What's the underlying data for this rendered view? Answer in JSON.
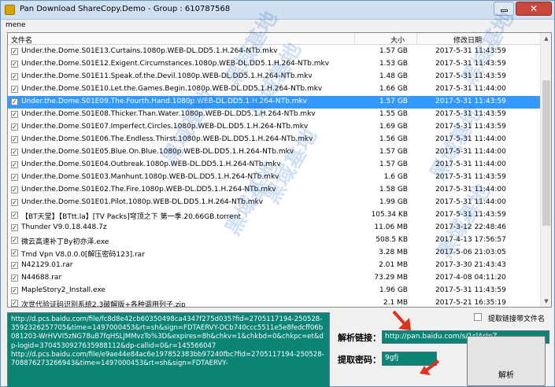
{
  "window": {
    "title": "Pan Download ShareCopy.Demo - Group : 610787568",
    "close_glyph": "✕"
  },
  "menu": {
    "items": [
      {
        "label": "mene"
      }
    ]
  },
  "file_list": {
    "columns": {
      "name": "文件名",
      "size": "大小",
      "date": "修改日期"
    },
    "rows": [
      {
        "name": "Under.the.Dome.S01E13.Curtains.1080p.WEB-DL.DD5.1.H.264-NTb.mkv",
        "size": "1.57 GB",
        "date": "2017-5-31 11:43:59",
        "checked": true,
        "selected": false
      },
      {
        "name": "Under.the.Dome.S01E12.Exigent.Circumstances.1080p.WEB-DL.DD5.1.H.264-NTb.mkv",
        "size": "1.53 GB",
        "date": "2017-5-31 11:43:59",
        "checked": true,
        "selected": false
      },
      {
        "name": "Under.the.Dome.S01E11.Speak.of.the.Devil.1080p.WEB-DL.DD5.1.H.264-NTb.mkv",
        "size": "1.48 GB",
        "date": "2017-5-31 11:43:59",
        "checked": true,
        "selected": false
      },
      {
        "name": "Under.the.Dome.S01E10.Let.the.Games.Begin.1080p.WEB-DL.DD5.1.H.264-NTb.mkv",
        "size": "1.66 GB",
        "date": "2017-5-31 11:44:00",
        "checked": true,
        "selected": false
      },
      {
        "name": "Under.the.Dome.S01E09.The.Fourth.Hand.1080p.WEB-DL.DD5.1.H.264-NTb.mkv",
        "size": "1.57 GB",
        "date": "2017-5-31 11:43:59",
        "checked": true,
        "selected": true
      },
      {
        "name": "Under.the.Dome.S01E08.Thicker.Than.Water.1080p.WEB-DL.DD5.1.H.264-NTb.mkv",
        "size": "1.55 GB",
        "date": "2017-5-31 11:43:59",
        "checked": true,
        "selected": false
      },
      {
        "name": "Under.the.Dome.S01E07.Imperfect.Circles.1080p.WEB-DL.DD5.1.H.264-NTb.mkv",
        "size": "1.69 GB",
        "date": "2017-5-31 11:43:59",
        "checked": true,
        "selected": false
      },
      {
        "name": "Under.the.Dome.S01E06.The.Endless.Thirst.1080p.WEB-DL.DD5.1.H.264-NTb.mkv",
        "size": "1.56 GB",
        "date": "2017-5-31 11:44:00",
        "checked": true,
        "selected": false
      },
      {
        "name": "Under.the.Dome.S01E05.Blue.On.Blue.1080p.WEB-DL.DD5.1.H.264-NTb.mkv",
        "size": "1.57 GB",
        "date": "2017-5-31 11:44:00",
        "checked": true,
        "selected": false
      },
      {
        "name": "Under.the.Dome.S01E04.Outbreak.1080p.WEB-DL.DD5.1.H.264-NTb.mkv",
        "size": "1.57 GB",
        "date": "2017-5-31 11:44:00",
        "checked": true,
        "selected": false
      },
      {
        "name": "Under.the.Dome.S01E03.Manhunt.1080p.WEB-DL.DD5.1.H.264-NTb.mkv",
        "size": "1.6 GB",
        "date": "2017-5-31 11:43:59",
        "checked": true,
        "selected": false
      },
      {
        "name": "Under.the.Dome.S01E02.The.Fire.1080p.WEB-DL.DD5.1.H.264-NTb.mkv",
        "size": "1.58 GB",
        "date": "2017-5-31 11:44:00",
        "checked": true,
        "selected": false
      },
      {
        "name": "Under.the.Dome.S01E01.Pilot.1080p.WEB-DL.DD5.1.H.264-NTb.mkv",
        "size": "1.99 GB",
        "date": "2017-5-31 11:44:00",
        "checked": true,
        "selected": false
      },
      {
        "name": "【BT天堂】【BTtt.la】[TV Packs]穹顶之下 第一季.20.66GB.torrent",
        "size": "105.34 KB",
        "date": "2017-5-31 11:43:59",
        "checked": true,
        "selected": false
      },
      {
        "name": "Thunder V9.0.18.448.7z",
        "size": "11.06 MB",
        "date": "2017-3-12 22:48:46",
        "checked": true,
        "selected": false
      },
      {
        "name": "微云高速补丁By初亦泽.exe",
        "size": "508.5 KB",
        "date": "2017-4-13 17:56:57",
        "checked": true,
        "selected": false
      },
      {
        "name": "Tmd Vpn V8.0.0.0[解压密码123].rar",
        "size": "3.28 MB",
        "date": "2017-5-06 21:03:05",
        "checked": true,
        "selected": false
      },
      {
        "name": "N42129.01.rar",
        "size": "2.01 MB",
        "date": "2017-3-30 21:43:43",
        "checked": true,
        "selected": false
      },
      {
        "name": "N44688.rar",
        "size": "73.29 MB",
        "date": "2017-4-08 04:11:20",
        "checked": true,
        "selected": false
      },
      {
        "name": "MapleStory2_Install.exe",
        "size": "1.96 GB",
        "date": "2017-5-31 11:43:59",
        "checked": true,
        "selected": false
      },
      {
        "name": "次世代验证码识别系统2.3破解版+各种调用列子.zip",
        "size": "2.1 MB",
        "date": "2017-5-21 16:35:19",
        "checked": true,
        "selected": false
      }
    ]
  },
  "download_links": {
    "text": "http://d.pcs.baidu.com/file/fc8d8e42cb60350498ca4347f275d035?fid=2705117194-250528-3592326257705&time=1497000453&rt=sh&sign=FDTAERVY-DCb740ccc5511e5e8fedcff06b081203-WrHVVI5zNG78uB7fqHSLJMMvzTo%3D&expires=8h&chkv=1&chkbd=0&chkpc=et&dp-logid=3704530927635988112&dp-callid=0&r=145566047\nhttp://d.pcs.baidu.com/file/e9ae44e84ac6e197852383bb97240fbc?fid=2705117194-250528-708876273266943&time=1497000453&rt=sh&sign=FDTAERVY-"
  },
  "keep_link_option": {
    "label": "提取链接带文件名",
    "checked": false
  },
  "parse_link": {
    "label": "解析链接：",
    "value": "http://pan.baidu.com/s/1slArJnZ"
  },
  "extract_code": {
    "label": "提取密码：",
    "value": "9gfj"
  },
  "parse_button": {
    "label": "解析"
  },
  "colors": {
    "accent_teal": "#0b8375",
    "selection": "#3399ff",
    "annotation_red": "#e0301e"
  },
  "watermark_text": "黑域基地"
}
